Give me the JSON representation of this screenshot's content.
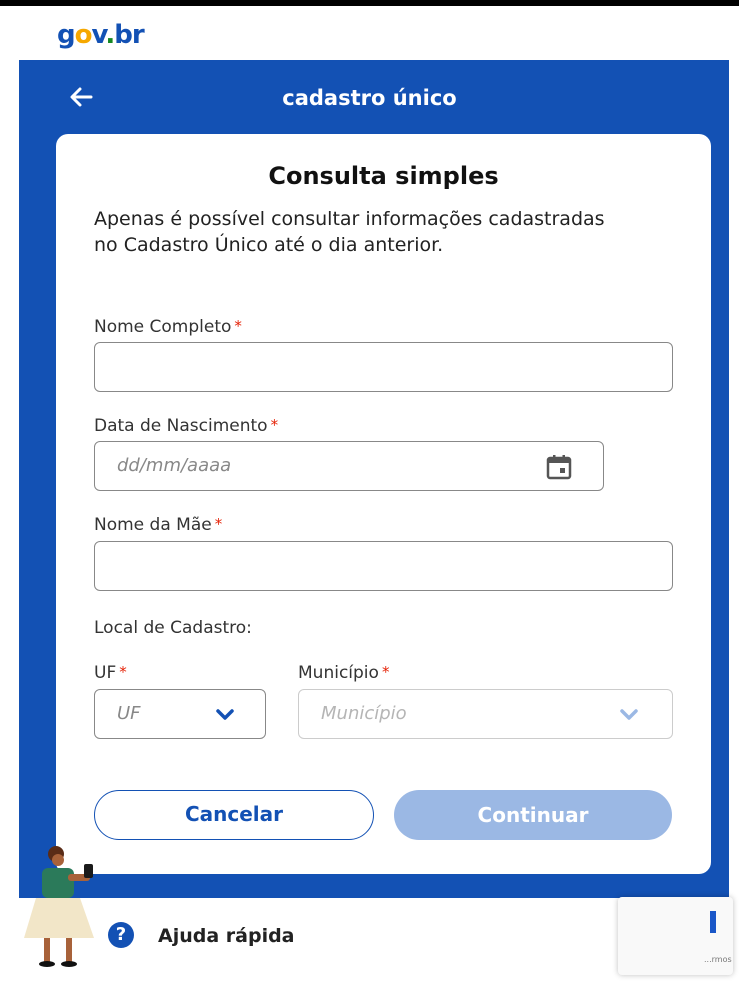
{
  "brand": {
    "logo_text": "gov.br"
  },
  "header": {
    "title": "cadastro único"
  },
  "card": {
    "title": "Consulta simples",
    "intro": "Apenas é possível consultar informações cadastradas no Cadastro Único até o dia anterior.",
    "fields": {
      "nome_completo": {
        "label": "Nome Completo",
        "required_mark": "*",
        "value": ""
      },
      "data_nascimento": {
        "label": "Data de Nascimento",
        "required_mark": "*",
        "placeholder": "dd/mm/aaaa"
      },
      "nome_mae": {
        "label": "Nome da Mãe",
        "required_mark": "*",
        "value": ""
      }
    },
    "local_label": "Local de Cadastro:",
    "uf": {
      "label": "UF",
      "required_mark": "*",
      "placeholder": "UF"
    },
    "municipio": {
      "label": "Município",
      "required_mark": "*",
      "placeholder": "Município"
    },
    "buttons": {
      "cancel": "Cancelar",
      "continue": "Continuar"
    }
  },
  "help": {
    "label": "Ajuda rápida",
    "icon_char": "?"
  },
  "recaptcha": {
    "text": "...rmos"
  },
  "colors": {
    "primary": "#1351b4",
    "required": "#e52207",
    "disabled_button": "#9bb8e4",
    "brand_yellow": "#f6a800",
    "brand_green": "#168821"
  },
  "icons": {
    "back": "arrow-left-icon",
    "calendar": "calendar-icon",
    "chevron": "chevron-down-icon",
    "help": "question-circle-icon"
  }
}
